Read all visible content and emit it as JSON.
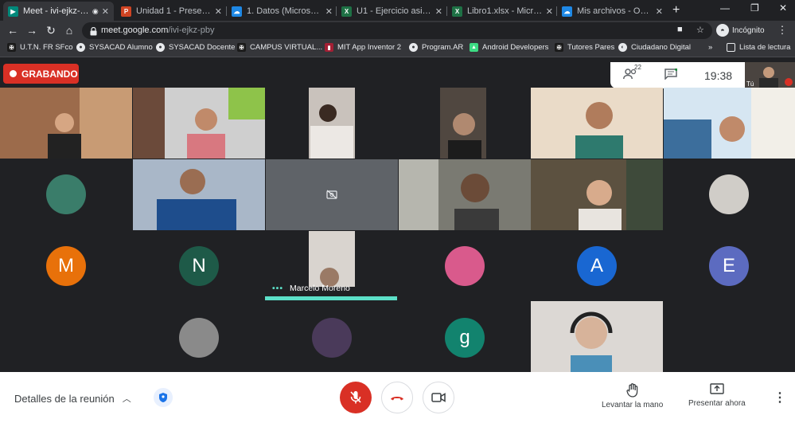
{
  "browser": {
    "tabs": [
      {
        "label": "Meet - ivi-ejkz-pby",
        "icon": "meet-icon",
        "active": true
      },
      {
        "label": "Unidad 1 - Presentación",
        "icon": "powerpoint-icon"
      },
      {
        "label": "1. Datos (Microsoft Exce",
        "icon": "onedrive-icon"
      },
      {
        "label": "U1 - Ejercicio asincróni",
        "icon": "excel-icon"
      },
      {
        "label": "Libro1.xlsx - Microsoft E",
        "icon": "excel-icon"
      },
      {
        "label": "Mis archivos - OneDrive",
        "icon": "onedrive-icon"
      }
    ],
    "url_host": "meet.google.com",
    "url_path": "/ivi-ejkz-pby",
    "incognito_label": "Incógnito",
    "bookmarks": [
      {
        "label": "U.T.N. FR SFco",
        "icon": "utn-icon"
      },
      {
        "label": "SYSACAD Alumno",
        "icon": "globe-icon"
      },
      {
        "label": "SYSACAD Docente",
        "icon": "globe-icon"
      },
      {
        "label": "CAMPUS VIRTUAL...",
        "icon": "campus-icon"
      },
      {
        "label": "MIT App Inventor 2",
        "icon": "mit-icon"
      },
      {
        "label": "Program.AR",
        "icon": "globe-icon"
      },
      {
        "label": "Android Developers",
        "icon": "android-icon"
      },
      {
        "label": "Tutores Pares",
        "icon": "utn-icon"
      },
      {
        "label": "Ciudadano Digital",
        "icon": "ciudadano-icon"
      }
    ],
    "bookmarks_overflow": "»",
    "reading_list": "Lista de lectura"
  },
  "meet": {
    "recording_label": "GRABANDO",
    "participant_count": "22",
    "clock": "19:38",
    "self_label": "Tú",
    "speaker_name": "Marcelo Moreno",
    "avatars": {
      "m": "M",
      "n": "N",
      "a": "A",
      "e": "E",
      "g": "g"
    },
    "colors": {
      "m": "#e8710a",
      "n": "#1e5a48",
      "a": "#1967d2",
      "e": "#5c6bc0",
      "g": "#12836e",
      "recording": "#d93025",
      "speaking": "#5ce0c8"
    }
  },
  "controls": {
    "details_label": "Detalles de la reunión",
    "raise_hand_label": "Levantar la mano",
    "present_label": "Presentar ahora"
  }
}
